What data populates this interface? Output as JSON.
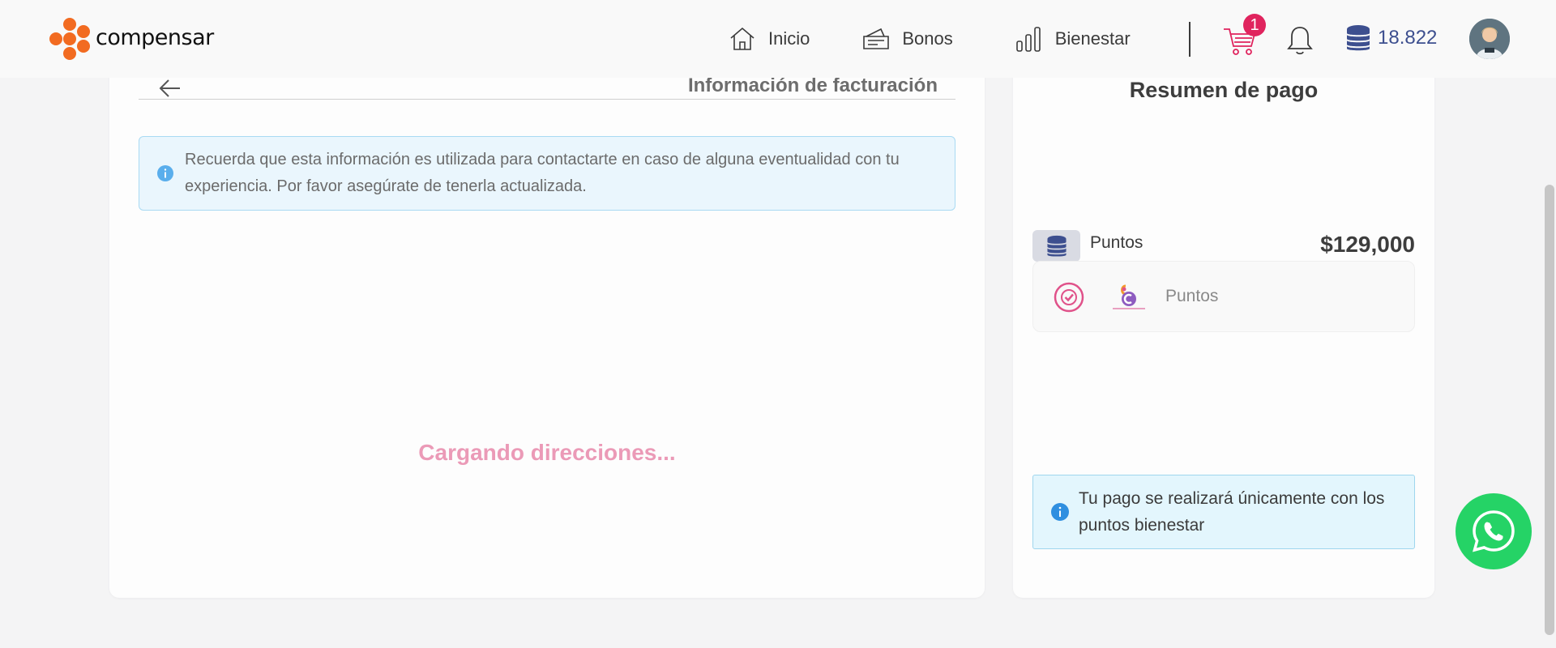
{
  "header": {
    "logo_text": "compensar",
    "nav": [
      {
        "label": "Inicio",
        "icon": "home-icon"
      },
      {
        "label": "Bonos",
        "icon": "ticket-icon"
      },
      {
        "label": "Bienestar",
        "icon": "bar-chart-icon"
      }
    ],
    "cart_count": "1",
    "points_balance": "18.822"
  },
  "billing": {
    "title": "Información de facturación",
    "info_message": "Recuerda que esta información es utilizada para contactarte en caso de alguna eventualidad con tu experiencia. Por favor asegúrate de tenerla actualizada.",
    "loading_text": "Cargando direcciones..."
  },
  "summary": {
    "title": "Resumen de pago",
    "points_label": "Puntos",
    "points_total": "$129,000",
    "method_label": "Puntos",
    "notice": "Tu pago se realizará únicamente con los puntos bienestar"
  },
  "colors": {
    "brand_orange": "#f26b21",
    "accent_pink": "#e0245e",
    "loading_pink": "#eb9ab7",
    "points_blue": "#3d4f8f",
    "whatsapp_green": "#25d366",
    "info_blue": "#2f8fe0"
  }
}
